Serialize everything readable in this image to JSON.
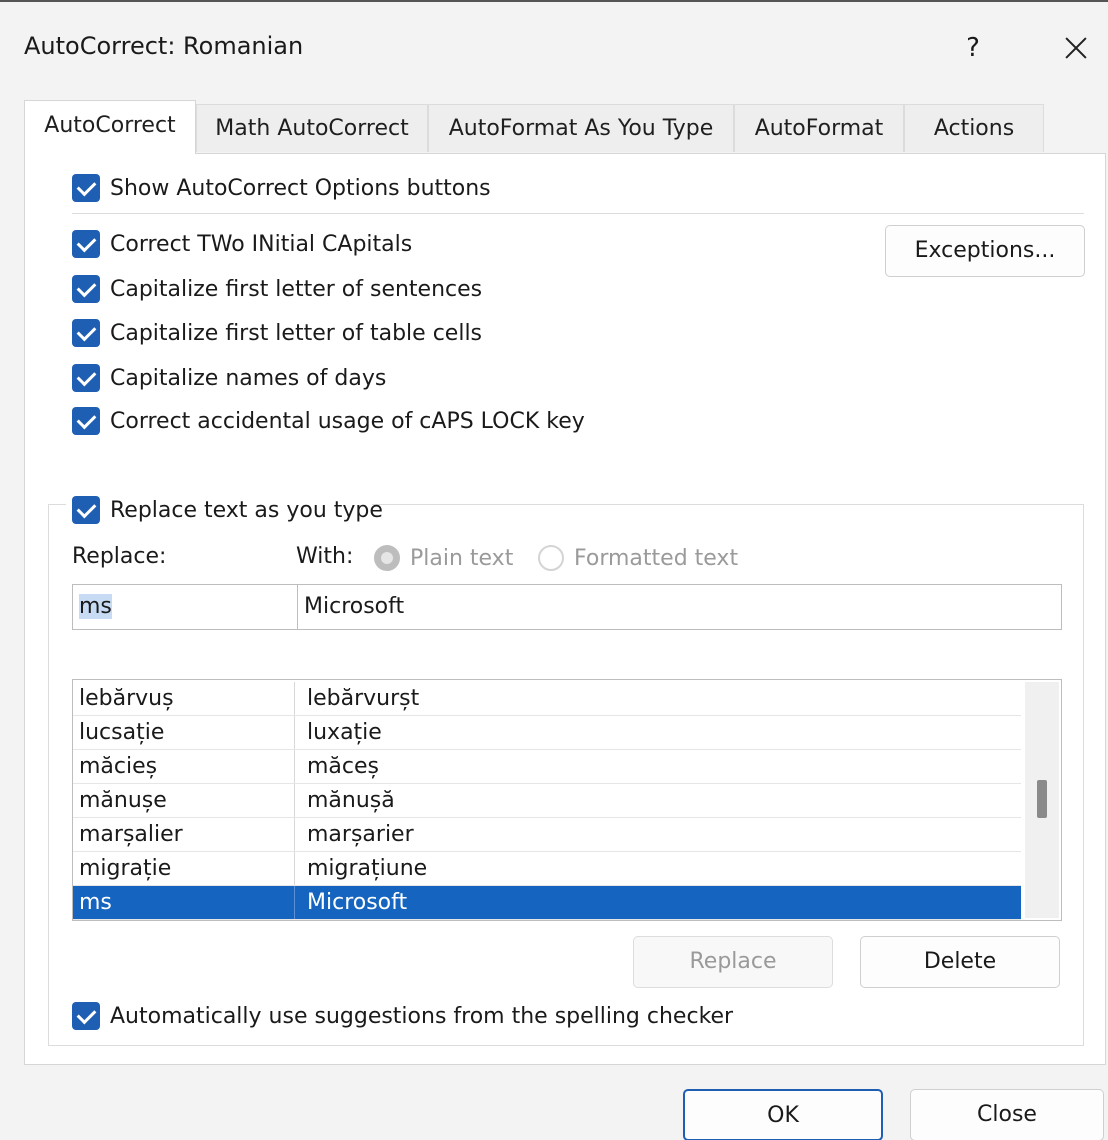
{
  "window": {
    "title": "AutoCorrect: Romanian",
    "help_label": "?"
  },
  "tabs": [
    {
      "label": "AutoCorrect",
      "active": true
    },
    {
      "label": "Math AutoCorrect",
      "active": false
    },
    {
      "label": "AutoFormat As You Type",
      "active": false
    },
    {
      "label": "AutoFormat",
      "active": false
    },
    {
      "label": "Actions",
      "active": false
    }
  ],
  "options": {
    "show_buttons": {
      "label": "Show AutoCorrect Options buttons",
      "checked": true
    },
    "two_initial": {
      "label": "Correct TWo INitial CApitals",
      "checked": true
    },
    "cap_sentences": {
      "label": "Capitalize first letter of sentences",
      "checked": true
    },
    "cap_table": {
      "label": "Capitalize first letter of table cells",
      "checked": true
    },
    "cap_days": {
      "label": "Capitalize names of days",
      "checked": true
    },
    "caps_lock": {
      "label": "Correct accidental usage of cAPS LOCK key",
      "checked": true
    },
    "replace_as_type": {
      "label": "Replace text as you type",
      "checked": true
    },
    "spelling": {
      "label": "Automatically use suggestions from the spelling checker",
      "checked": true
    }
  },
  "exceptions_button": "Exceptions...",
  "replace_section": {
    "replace_label": "Replace:",
    "with_label": "With:",
    "plain_text": "Plain text",
    "formatted_text": "Formatted text",
    "replace_value": "ms",
    "with_value": "Microsoft"
  },
  "entries": [
    {
      "replace": "lebărvuș",
      "with": "lebărvurșt",
      "selected": false
    },
    {
      "replace": "lucsație",
      "with": "luxație",
      "selected": false
    },
    {
      "replace": "măcieș",
      "with": "măceș",
      "selected": false
    },
    {
      "replace": "mănușe",
      "with": "mănușă",
      "selected": false
    },
    {
      "replace": "marșalier",
      "with": "marșarier",
      "selected": false
    },
    {
      "replace": "migrație",
      "with": "migrațiune",
      "selected": false
    },
    {
      "replace": "ms",
      "with": "Microsoft",
      "selected": true
    }
  ],
  "list_buttons": {
    "replace": "Replace",
    "delete": "Delete"
  },
  "footer": {
    "ok": "OK",
    "close": "Close"
  },
  "colors": {
    "accent": "#1f5fb3",
    "selection": "#1565c0"
  }
}
